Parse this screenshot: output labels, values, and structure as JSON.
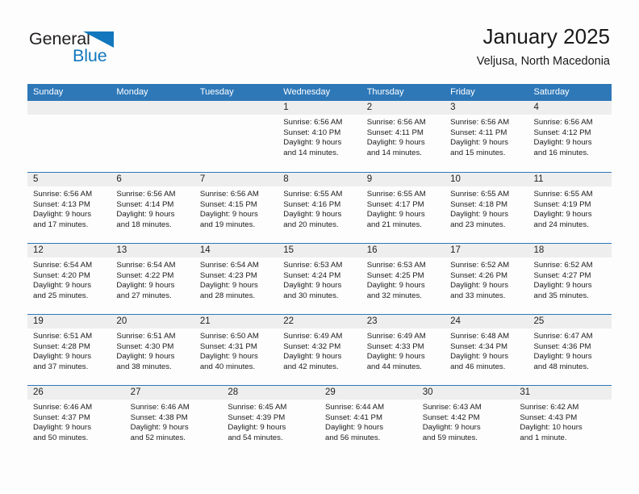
{
  "logo": {
    "text_primary": "General",
    "text_secondary": "Blue",
    "primary_color": "#231f20",
    "secondary_color": "#1277bc"
  },
  "header": {
    "title": "January 2025",
    "subtitle": "Veljusa, North Macedonia"
  },
  "theme": {
    "header_blue": "#2e78b8",
    "day_strip_gray": "#eeeeee",
    "background": "#fdfdfd"
  },
  "calendar": {
    "weekdays": [
      "Sunday",
      "Monday",
      "Tuesday",
      "Wednesday",
      "Thursday",
      "Friday",
      "Saturday"
    ],
    "weeks": [
      [
        {
          "day": "",
          "lines": []
        },
        {
          "day": "",
          "lines": []
        },
        {
          "day": "",
          "lines": []
        },
        {
          "day": "1",
          "lines": [
            "Sunrise: 6:56 AM",
            "Sunset: 4:10 PM",
            "Daylight: 9 hours",
            "and 14 minutes."
          ]
        },
        {
          "day": "2",
          "lines": [
            "Sunrise: 6:56 AM",
            "Sunset: 4:11 PM",
            "Daylight: 9 hours",
            "and 14 minutes."
          ]
        },
        {
          "day": "3",
          "lines": [
            "Sunrise: 6:56 AM",
            "Sunset: 4:11 PM",
            "Daylight: 9 hours",
            "and 15 minutes."
          ]
        },
        {
          "day": "4",
          "lines": [
            "Sunrise: 6:56 AM",
            "Sunset: 4:12 PM",
            "Daylight: 9 hours",
            "and 16 minutes."
          ]
        }
      ],
      [
        {
          "day": "5",
          "lines": [
            "Sunrise: 6:56 AM",
            "Sunset: 4:13 PM",
            "Daylight: 9 hours",
            "and 17 minutes."
          ]
        },
        {
          "day": "6",
          "lines": [
            "Sunrise: 6:56 AM",
            "Sunset: 4:14 PM",
            "Daylight: 9 hours",
            "and 18 minutes."
          ]
        },
        {
          "day": "7",
          "lines": [
            "Sunrise: 6:56 AM",
            "Sunset: 4:15 PM",
            "Daylight: 9 hours",
            "and 19 minutes."
          ]
        },
        {
          "day": "8",
          "lines": [
            "Sunrise: 6:55 AM",
            "Sunset: 4:16 PM",
            "Daylight: 9 hours",
            "and 20 minutes."
          ]
        },
        {
          "day": "9",
          "lines": [
            "Sunrise: 6:55 AM",
            "Sunset: 4:17 PM",
            "Daylight: 9 hours",
            "and 21 minutes."
          ]
        },
        {
          "day": "10",
          "lines": [
            "Sunrise: 6:55 AM",
            "Sunset: 4:18 PM",
            "Daylight: 9 hours",
            "and 23 minutes."
          ]
        },
        {
          "day": "11",
          "lines": [
            "Sunrise: 6:55 AM",
            "Sunset: 4:19 PM",
            "Daylight: 9 hours",
            "and 24 minutes."
          ]
        }
      ],
      [
        {
          "day": "12",
          "lines": [
            "Sunrise: 6:54 AM",
            "Sunset: 4:20 PM",
            "Daylight: 9 hours",
            "and 25 minutes."
          ]
        },
        {
          "day": "13",
          "lines": [
            "Sunrise: 6:54 AM",
            "Sunset: 4:22 PM",
            "Daylight: 9 hours",
            "and 27 minutes."
          ]
        },
        {
          "day": "14",
          "lines": [
            "Sunrise: 6:54 AM",
            "Sunset: 4:23 PM",
            "Daylight: 9 hours",
            "and 28 minutes."
          ]
        },
        {
          "day": "15",
          "lines": [
            "Sunrise: 6:53 AM",
            "Sunset: 4:24 PM",
            "Daylight: 9 hours",
            "and 30 minutes."
          ]
        },
        {
          "day": "16",
          "lines": [
            "Sunrise: 6:53 AM",
            "Sunset: 4:25 PM",
            "Daylight: 9 hours",
            "and 32 minutes."
          ]
        },
        {
          "day": "17",
          "lines": [
            "Sunrise: 6:52 AM",
            "Sunset: 4:26 PM",
            "Daylight: 9 hours",
            "and 33 minutes."
          ]
        },
        {
          "day": "18",
          "lines": [
            "Sunrise: 6:52 AM",
            "Sunset: 4:27 PM",
            "Daylight: 9 hours",
            "and 35 minutes."
          ]
        }
      ],
      [
        {
          "day": "19",
          "lines": [
            "Sunrise: 6:51 AM",
            "Sunset: 4:28 PM",
            "Daylight: 9 hours",
            "and 37 minutes."
          ]
        },
        {
          "day": "20",
          "lines": [
            "Sunrise: 6:51 AM",
            "Sunset: 4:30 PM",
            "Daylight: 9 hours",
            "and 38 minutes."
          ]
        },
        {
          "day": "21",
          "lines": [
            "Sunrise: 6:50 AM",
            "Sunset: 4:31 PM",
            "Daylight: 9 hours",
            "and 40 minutes."
          ]
        },
        {
          "day": "22",
          "lines": [
            "Sunrise: 6:49 AM",
            "Sunset: 4:32 PM",
            "Daylight: 9 hours",
            "and 42 minutes."
          ]
        },
        {
          "day": "23",
          "lines": [
            "Sunrise: 6:49 AM",
            "Sunset: 4:33 PM",
            "Daylight: 9 hours",
            "and 44 minutes."
          ]
        },
        {
          "day": "24",
          "lines": [
            "Sunrise: 6:48 AM",
            "Sunset: 4:34 PM",
            "Daylight: 9 hours",
            "and 46 minutes."
          ]
        },
        {
          "day": "25",
          "lines": [
            "Sunrise: 6:47 AM",
            "Sunset: 4:36 PM",
            "Daylight: 9 hours",
            "and 48 minutes."
          ]
        }
      ],
      [
        {
          "day": "26",
          "lines": [
            "Sunrise: 6:46 AM",
            "Sunset: 4:37 PM",
            "Daylight: 9 hours",
            "and 50 minutes."
          ]
        },
        {
          "day": "27",
          "lines": [
            "Sunrise: 6:46 AM",
            "Sunset: 4:38 PM",
            "Daylight: 9 hours",
            "and 52 minutes."
          ]
        },
        {
          "day": "28",
          "lines": [
            "Sunrise: 6:45 AM",
            "Sunset: 4:39 PM",
            "Daylight: 9 hours",
            "and 54 minutes."
          ]
        },
        {
          "day": "29",
          "lines": [
            "Sunrise: 6:44 AM",
            "Sunset: 4:41 PM",
            "Daylight: 9 hours",
            "and 56 minutes."
          ]
        },
        {
          "day": "30",
          "lines": [
            "Sunrise: 6:43 AM",
            "Sunset: 4:42 PM",
            "Daylight: 9 hours",
            "and 59 minutes."
          ]
        },
        {
          "day": "31",
          "lines": [
            "Sunrise: 6:42 AM",
            "Sunset: 4:43 PM",
            "Daylight: 10 hours",
            "and 1 minute."
          ]
        }
      ]
    ]
  }
}
